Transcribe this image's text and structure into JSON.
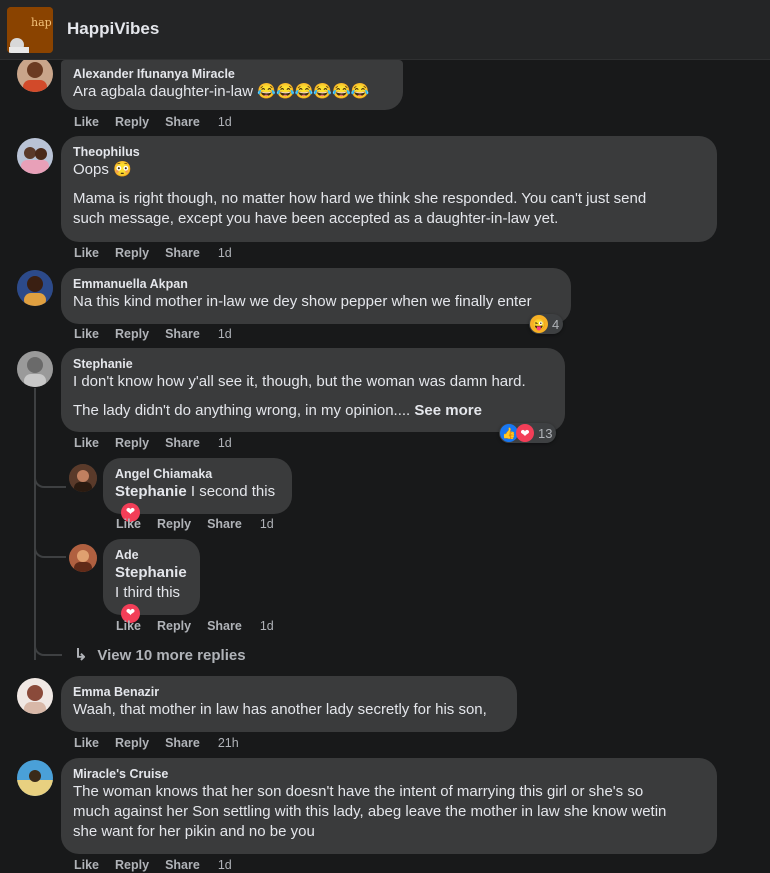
{
  "header": {
    "page_name": "HappiVibes",
    "avatar_text": "hap"
  },
  "action_labels": {
    "like": "Like",
    "reply": "Reply",
    "share": "Share"
  },
  "comments": [
    {
      "author": "Alexander Ifunanya Miracle",
      "text": "Ara agbala daughter-in-law 😂😂😂😂😂😂",
      "time": "1d"
    },
    {
      "author": "Theophilus",
      "text1": "Oops 😳",
      "text2": "Mama is right though, no matter how hard we think she responded. You can't just send",
      "text3": "such message, except you have been accepted as a daughter-in-law yet.",
      "time": "1d"
    },
    {
      "author": "Emmanuella Akpan",
      "text": "Na this kind mother in-law we dey show pepper when we finally enter",
      "time": "1d",
      "reaction_count": "4"
    },
    {
      "author": "Stephanie",
      "text1": "I don't know how y'all see it, though, but the woman was damn hard.",
      "text2": "The lady didn't do anything wrong, in my opinion....",
      "see_more": "See more",
      "time": "1d",
      "reaction_count": "13"
    },
    {
      "author": "Emma Benazir",
      "text": "Waah, that mother in law has another lady secretly for his son,",
      "time": "21h"
    },
    {
      "author": "Miracle's Cruise",
      "text1": "The woman knows that her son doesn't have the intent of marrying this girl or she's so",
      "text2": "much against her Son settling with this lady, abeg leave the mother in law she know wetin",
      "text3": "she want for her pikin and no be you",
      "time": "1d"
    }
  ],
  "replies": [
    {
      "author": "Angel Chiamaka",
      "mention": "Stephanie",
      "text": "I second this",
      "time": "1d"
    },
    {
      "author": "Ade",
      "mention": "Stephanie",
      "text": "I third this",
      "time": "1d"
    }
  ],
  "view_more_replies": "View 10 more replies"
}
